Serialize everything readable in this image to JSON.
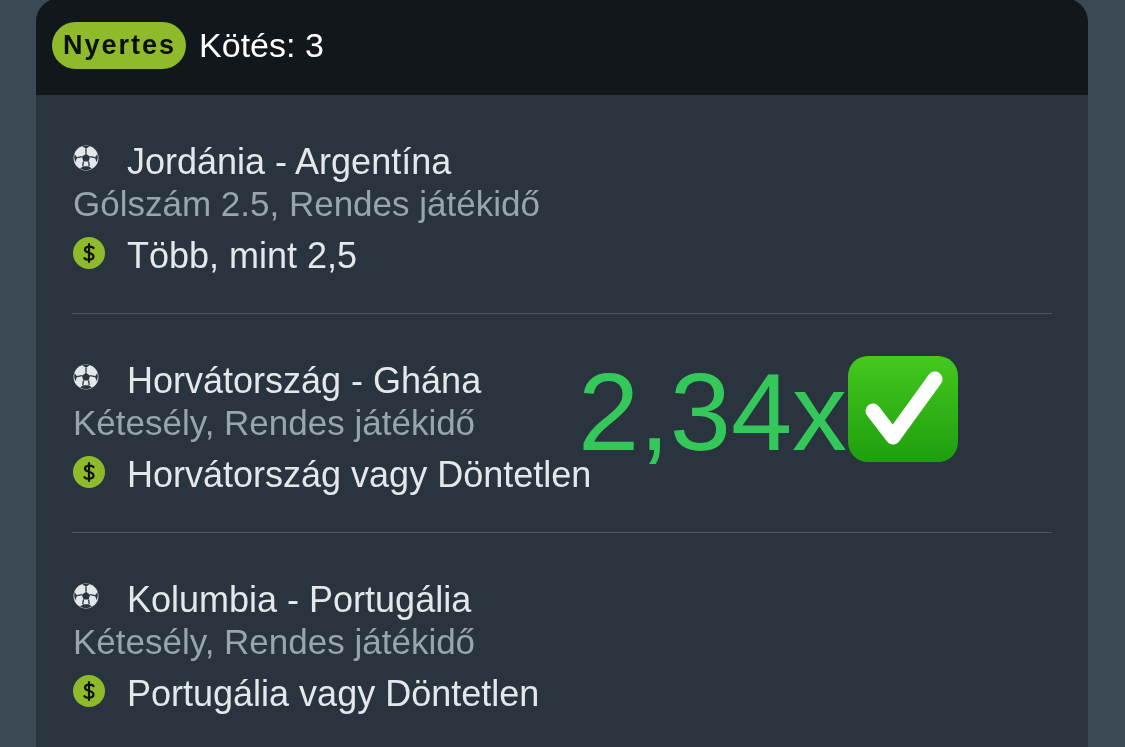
{
  "header": {
    "status_badge": "Nyertes",
    "title": "Kötés: 3"
  },
  "bets": [
    {
      "match": "Jordánia - Argentína",
      "market": "Gólszám 2.5, Rendes játékidő",
      "selection": "Több, mint 2,5"
    },
    {
      "match": "Horvátország - Ghána",
      "market": "Kétesély, Rendes játékidő",
      "selection": "Horvátország vagy Döntetlen"
    },
    {
      "match": "Kolumbia - Portugália",
      "market": "Kétesély, Rendes játékidő",
      "selection": "Portugália vagy Döntetlen"
    }
  ],
  "overlay": {
    "text": "2,34x"
  }
}
